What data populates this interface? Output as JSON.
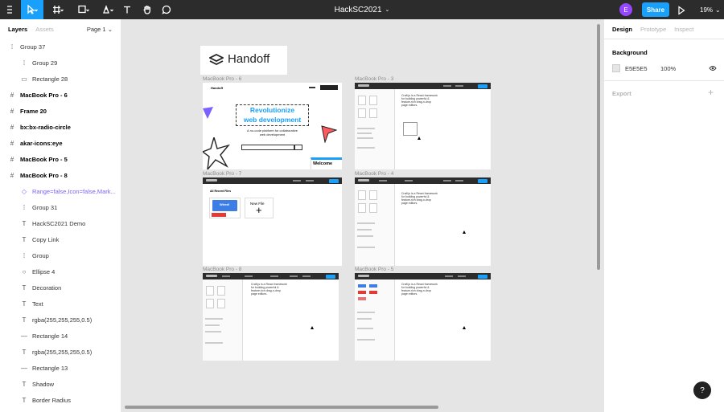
{
  "toolbar": {
    "title": "HackSC2021",
    "avatar_initial": "E",
    "share_label": "Share",
    "zoom": "19%"
  },
  "left_panel": {
    "tabs": [
      "Layers",
      "Assets"
    ],
    "page": "Page 1",
    "layers": [
      {
        "icon": "group",
        "name": "Group 37",
        "indent": 0,
        "style": "normal"
      },
      {
        "icon": "group",
        "name": "Group 29",
        "indent": 1,
        "style": "normal"
      },
      {
        "icon": "rect",
        "name": "Rectangle 28",
        "indent": 1,
        "style": "normal"
      },
      {
        "icon": "frame",
        "name": "MacBook Pro - 6",
        "indent": 0,
        "style": "bold"
      },
      {
        "icon": "frame",
        "name": "Frame 20",
        "indent": 0,
        "style": "bold"
      },
      {
        "icon": "frame",
        "name": "bx:bx-radio-circle",
        "indent": 0,
        "style": "bold"
      },
      {
        "icon": "frame",
        "name": "akar-icons:eye",
        "indent": 0,
        "style": "bold"
      },
      {
        "icon": "frame",
        "name": "MacBook Pro - 5",
        "indent": 0,
        "style": "bold"
      },
      {
        "icon": "frame",
        "name": "MacBook Pro - 8",
        "indent": 0,
        "style": "bold"
      },
      {
        "icon": "component",
        "name": "Range=false,Icon=false,Mark...",
        "indent": 1,
        "style": "comp"
      },
      {
        "icon": "group",
        "name": "Group 31",
        "indent": 1,
        "style": "normal"
      },
      {
        "icon": "text",
        "name": "HackSC2021 Demo",
        "indent": 1,
        "style": "normal"
      },
      {
        "icon": "text",
        "name": "Copy Link",
        "indent": 1,
        "style": "normal"
      },
      {
        "icon": "group",
        "name": "Group",
        "indent": 1,
        "style": "normal"
      },
      {
        "icon": "ellipse",
        "name": "Ellipse 4",
        "indent": 1,
        "style": "normal"
      },
      {
        "icon": "text",
        "name": "Decoration",
        "indent": 1,
        "style": "normal"
      },
      {
        "icon": "text",
        "name": "Text",
        "indent": 1,
        "style": "normal"
      },
      {
        "icon": "text",
        "name": "rgba(255,255,255,0.5)",
        "indent": 1,
        "style": "normal"
      },
      {
        "icon": "line",
        "name": "Rectangle 14",
        "indent": 1,
        "style": "normal"
      },
      {
        "icon": "text",
        "name": "rgba(255,255,255,0.5)",
        "indent": 1,
        "style": "normal"
      },
      {
        "icon": "line",
        "name": "Rectangle 13",
        "indent": 1,
        "style": "normal"
      },
      {
        "icon": "text",
        "name": "Shadow",
        "indent": 1,
        "style": "normal"
      },
      {
        "icon": "text",
        "name": "Border Radius",
        "indent": 1,
        "style": "normal"
      }
    ]
  },
  "canvas": {
    "logo_text": "Handoff",
    "frames": {
      "f6": {
        "label": "MacBook Pro - 6"
      },
      "f3": {
        "label": "MacBook Pro - 3"
      },
      "f7": {
        "label": "MacBook Pro - 7"
      },
      "f4": {
        "label": "MacBook Pro - 4"
      },
      "f8": {
        "label": "MacBook Pro - 8"
      },
      "f5": {
        "label": "MacBook Pro - 5"
      }
    },
    "hero": {
      "brand": "Handoff",
      "headline1": "Revolutionize",
      "headline2": "web development",
      "tagline1": "A no-code platform for collaborative",
      "tagline2": "web development",
      "welcome": "Welcome"
    },
    "f7_content": {
      "heading": "All Recent Files",
      "card_btn": "Wired!",
      "new_file": "New File"
    },
    "editor_text": [
      "Craft.js is a React framework",
      "for building powerful &",
      "feature-rich drag-n-drop",
      "page editors."
    ]
  },
  "right_panel": {
    "tabs": [
      "Design",
      "Prototype",
      "Inspect"
    ],
    "background_title": "Background",
    "bg_hex": "E5E5E5",
    "bg_opacity": "100%",
    "export_title": "Export"
  }
}
